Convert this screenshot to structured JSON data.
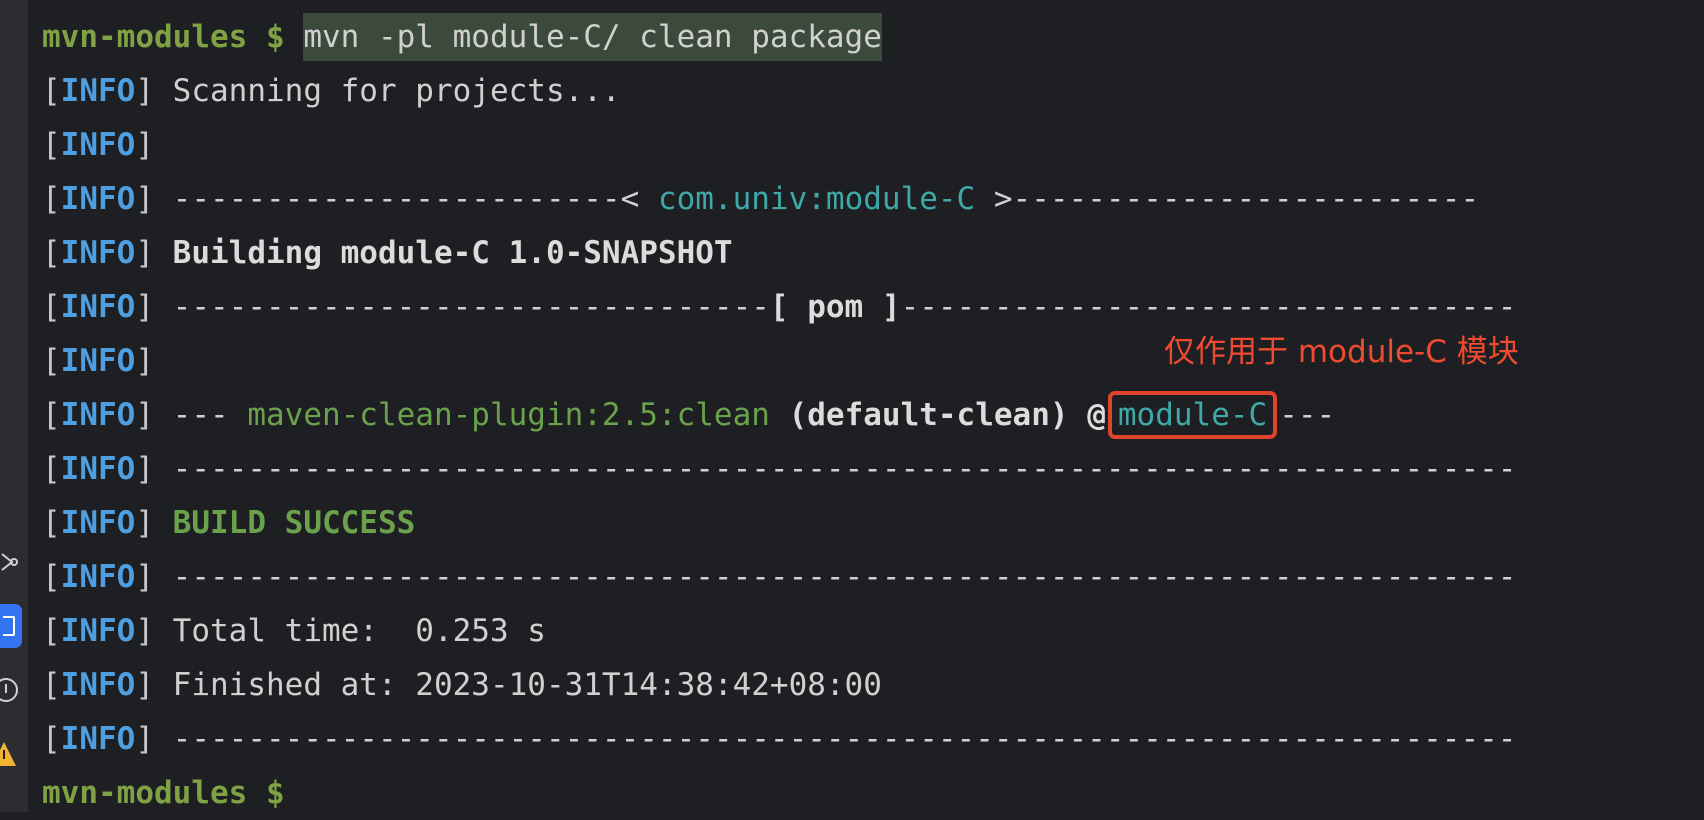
{
  "colors": {
    "background": "#1e1f22",
    "prompt": "#7ea244",
    "info_tag": "#4f9fe0",
    "artifact": "#3fa8a8",
    "plugin": "#6aa14a",
    "annotation": "#f04a30"
  },
  "sidebar_icons": [
    "run-icon",
    "terminal-icon",
    "info-icon",
    "warning-icon"
  ],
  "command": {
    "prompt": "mvn-modules $",
    "text": "mvn -pl module-C/ clean package"
  },
  "tag": {
    "open": "[",
    "level": "INFO",
    "close": "]"
  },
  "lines": {
    "scanning": "Scanning for projects...",
    "header_left": "------------------------< ",
    "artifact": "com.univ:module-C",
    "header_right": " >-------------------------",
    "building": "Building module-C 1.0-SNAPSHOT",
    "pom_left": "--------------------------------",
    "pom_label": "[ pom ]",
    "pom_right": "---------------------------------",
    "plugin_prefix": "--- ",
    "plugin": "maven-clean-plugin:2.5:clean",
    "execution": " (default-clean) @",
    "module": "module-C",
    "plugin_suffix": "---",
    "separator": "------------------------------------------------------------------------",
    "result": "BUILD SUCCESS",
    "total_time": "Total time:  0.253 s",
    "finished_at": "Finished at: 2023-10-31T14:38:42+08:00"
  },
  "final_prompt": "mvn-modules $",
  "annotation": "仅作用于 module-C 模块"
}
